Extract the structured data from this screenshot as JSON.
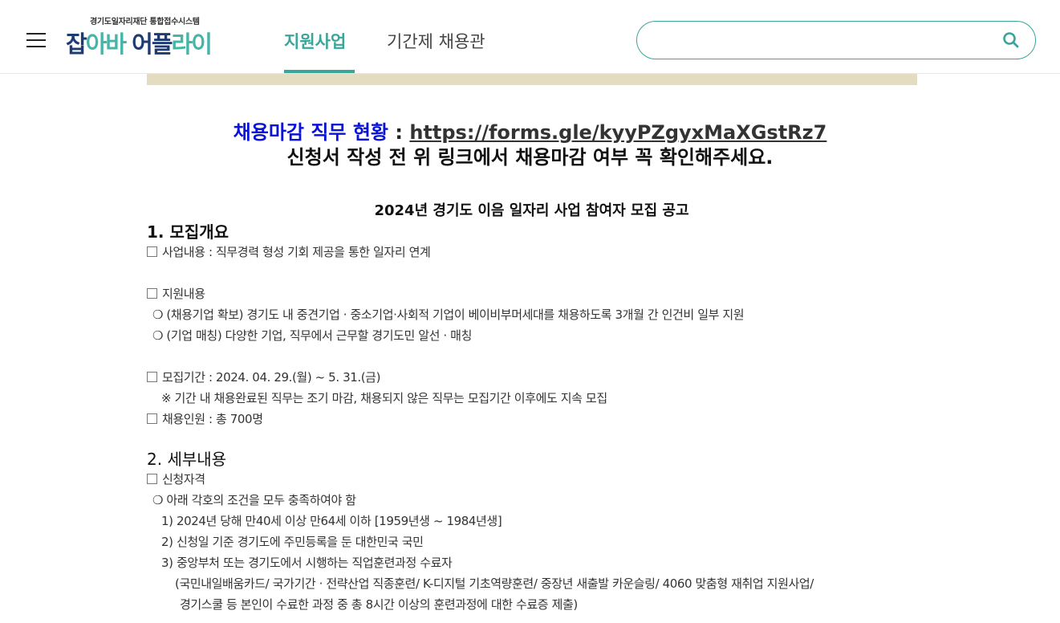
{
  "header": {
    "logo_subtitle": "경기도일자리재단 통합접수시스템",
    "logo_parts": [
      "잡",
      "아바 ",
      "어플",
      "라이"
    ],
    "tabs": [
      {
        "label": "지원사업",
        "active": true
      },
      {
        "label": "기간제 채용관",
        "active": false
      }
    ],
    "search": {
      "value": "",
      "placeholder": ""
    }
  },
  "colors": {
    "accent": "#3aa699",
    "brand_navy": "#1f3b73",
    "notice_blue": "#0a12d6",
    "banner": "#e4dcc1"
  },
  "icons": {
    "menu": "hamburger-icon",
    "search": "search-icon"
  },
  "notice": {
    "label": "채용마감 직무 현황",
    "separator": ":",
    "link": "https://forms.gle/kyyPZgyxMaXGstRz7",
    "line2": "신청서 작성 전 위 링크에서 채용마감 여부 꼭 확인해주세요."
  },
  "document": {
    "title": "2024년 경기도 이음 일자리 사업 참여자 모집 공고",
    "section1": {
      "heading": "1. 모집개요",
      "lines": [
        "사업내용 : 직무경력 형성 기회 제공을 통한 일자리 연계",
        "지원내용",
        "❍ (채용기업 확보) 경기도 내 중견기업 · 중소기업·사회적 기업이 베이비부머세대를 채용하도록 3개월 간 인건비 일부 지원",
        "❍ (기업 매칭) 다양한 기업, 직무에서 근무할 경기도민 알선 · 매칭",
        "모집기간 : 2024. 04. 29.(월) ~ 5. 31.(금)",
        "※ 기간 내 채용완료된 직무는 조기 마감, 채용되지 않은 직무는 모집기간 이후에도 지속 모집",
        "채용인원 : 총 700명"
      ]
    },
    "section2": {
      "heading": "2. 세부내용",
      "lines": [
        "신청자격",
        "❍ 아래 각호의 조건을 모두 충족하여야 함",
        "1) 2024년 당해 만40세 이상 만64세 이하 [1959년생 ~ 1984년생]",
        "2) 신청일 기준 경기도에 주민등록을 둔 대한민국 국민",
        "3) 중앙부처 또는 경기도에서 시행하는 직업훈련과정 수료자",
        "(국민내일배움카드/ 국가기간 · 전략산업 직종훈련/ K-디지털 기초역량훈련/ 중장년 새출발 카운슬링/ 4060 맞춤형 재취업 지원사업/",
        "경기스쿨 등 본인이 수료한 과정 중 총 8시간 이상의 훈련과정에 대한 수료증 제출)"
      ]
    }
  }
}
